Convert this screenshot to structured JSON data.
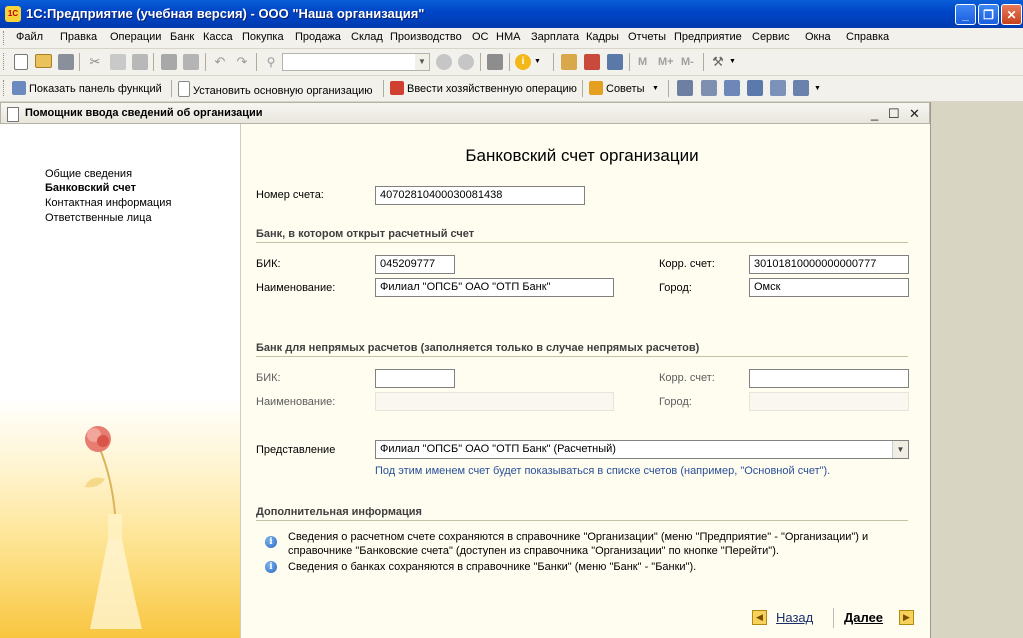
{
  "window": {
    "app_icon_text": "1С",
    "title": "1С:Предприятие (учебная версия) - ООО \"Наша организация\"",
    "btn_min": "_",
    "btn_max": "❐",
    "btn_close": "✕"
  },
  "menu": [
    "Файл",
    "Правка",
    "Операции",
    "Банк",
    "Касса",
    "Покупка",
    "Продажа",
    "Склад",
    "Производство",
    "ОС",
    "НМА",
    "Зарплата",
    "Кадры",
    "Отчеты",
    "Предприятие",
    "Сервис",
    "Окна",
    "Справка"
  ],
  "toolbar1": {
    "m_labels": [
      "M",
      "M+",
      "M-"
    ]
  },
  "toolbar2": {
    "show_panel": "Показать панель функций",
    "set_org": "Установить основную организацию",
    "enter_op": "Ввести хозяйственную операцию",
    "tips": "Советы"
  },
  "doc_window": {
    "title": "Помощник ввода сведений об организации",
    "btn_min": "_",
    "btn_max": "☐",
    "btn_close": "✕"
  },
  "nav": [
    {
      "label": "Общие сведения"
    },
    {
      "label": "Банковский счет"
    },
    {
      "label": "Контактная информация"
    },
    {
      "label": "Ответственные лица"
    }
  ],
  "form": {
    "title": "Банковский счет организации",
    "account_number_label": "Номер счета:",
    "account_number": "40702810400030081438",
    "bank_section": "Банк, в котором открыт расчетный счет",
    "bik_label": "БИК:",
    "bik": "045209777",
    "corr_label": "Корр. счет:",
    "corr": "30101810000000000777",
    "name_label": "Наименование:",
    "name": "Филиал \"ОПСБ\" ОАО \"ОТП Банк\"",
    "city_label": "Город:",
    "city": "Омск",
    "indirect_section": "Банк для непрямых расчетов (заполняется только в случае непрямых расчетов)",
    "indirect_bik_label": "БИК:",
    "indirect_bik": "",
    "indirect_corr_label": "Корр. счет:",
    "indirect_corr": "",
    "indirect_name_label": "Наименование:",
    "indirect_name": "",
    "indirect_city_label": "Город:",
    "indirect_city": "",
    "presentation_label": "Представление",
    "presentation": "Филиал \"ОПСБ\" ОАО \"ОТП Банк\" (Расчетный)",
    "presentation_hint": "Под этим именем счет будет показываться в списке счетов (например, \"Основной счет\").",
    "extra_section": "Дополнительная информация",
    "info1_line1": "Сведения о расчетном счете сохраняются в справочнике \"Организации\" (меню \"Предприятие\" - \"Организации\") и",
    "info1_line2": "справочнике \"Банковские счета\" (доступен из справочника \"Организации\" по кнопке \"Перейти\").",
    "info2": "Сведения о банках сохраняются в справочнике \"Банки\" (меню \"Банк\" - \"Банки\").",
    "back": "Назад",
    "next": "Далее"
  }
}
